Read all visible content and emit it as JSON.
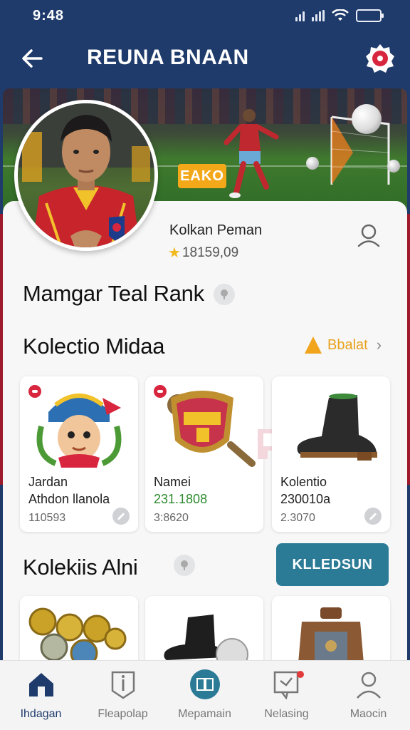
{
  "status_bar": {
    "time": "9:48"
  },
  "header": {
    "title": "REUNA BNAAN",
    "back_icon": "arrow-left-icon",
    "badge_icon": "gear-badge-icon"
  },
  "hero": {
    "tag": "EAKO"
  },
  "profile": {
    "name": "Kolkan Peman",
    "score": "18159,09"
  },
  "rank": {
    "title": "Mamgar Teal Rank"
  },
  "collection": {
    "title": "Kolectio Midaa",
    "see_all": "Bbalat",
    "items": [
      {
        "line1": "Jardan",
        "line2": "Athdon llanola",
        "line3": "110593"
      },
      {
        "line1": "Namei",
        "line2": "231.1808",
        "line3": "3:8620"
      },
      {
        "line1": "Kolentio",
        "line2": "230010a",
        "line3": "2.3070"
      }
    ]
  },
  "collection2": {
    "title": "Kolekiis Alni",
    "button": "KLLEDSUN"
  },
  "nav": {
    "items": [
      {
        "label": "Ihdagan",
        "icon": "home-icon"
      },
      {
        "label": "Fleapolap",
        "icon": "shield-info-icon"
      },
      {
        "label": "Mepamain",
        "icon": "book-icon"
      },
      {
        "label": "Nelasing",
        "icon": "chat-icon"
      },
      {
        "label": "Maocin",
        "icon": "user-icon"
      }
    ]
  },
  "colors": {
    "primary": "#1f3b6b",
    "accent": "#e8a21b",
    "cta": "#2b7a96",
    "alert": "#d7263d"
  }
}
